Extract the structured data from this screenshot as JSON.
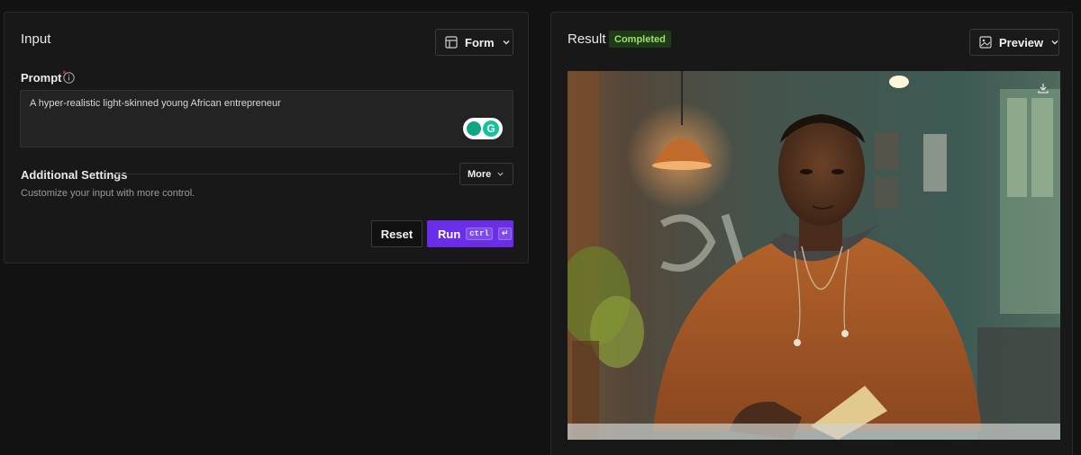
{
  "input": {
    "title": "Input",
    "view_button": "Form",
    "prompt_label": "Prompt",
    "required_mark": "*",
    "prompt_value": "A hyper-realistic light-skinned young African entrepreneur",
    "additional_settings_title": "Additional Settings",
    "more_button": "More",
    "settings_subtitle": "Customize your input with more control.",
    "reset_button": "Reset",
    "run_button": "Run",
    "run_shortcut": "ctrl",
    "run_shortcut_key": "↵"
  },
  "result": {
    "title": "Result",
    "status": "Completed",
    "view_button": "Preview",
    "image_alt": "Generated portrait image"
  },
  "colors": {
    "accent": "#6b2ee8",
    "badge_bg": "#1e3a18",
    "badge_text": "#9ee06a"
  }
}
